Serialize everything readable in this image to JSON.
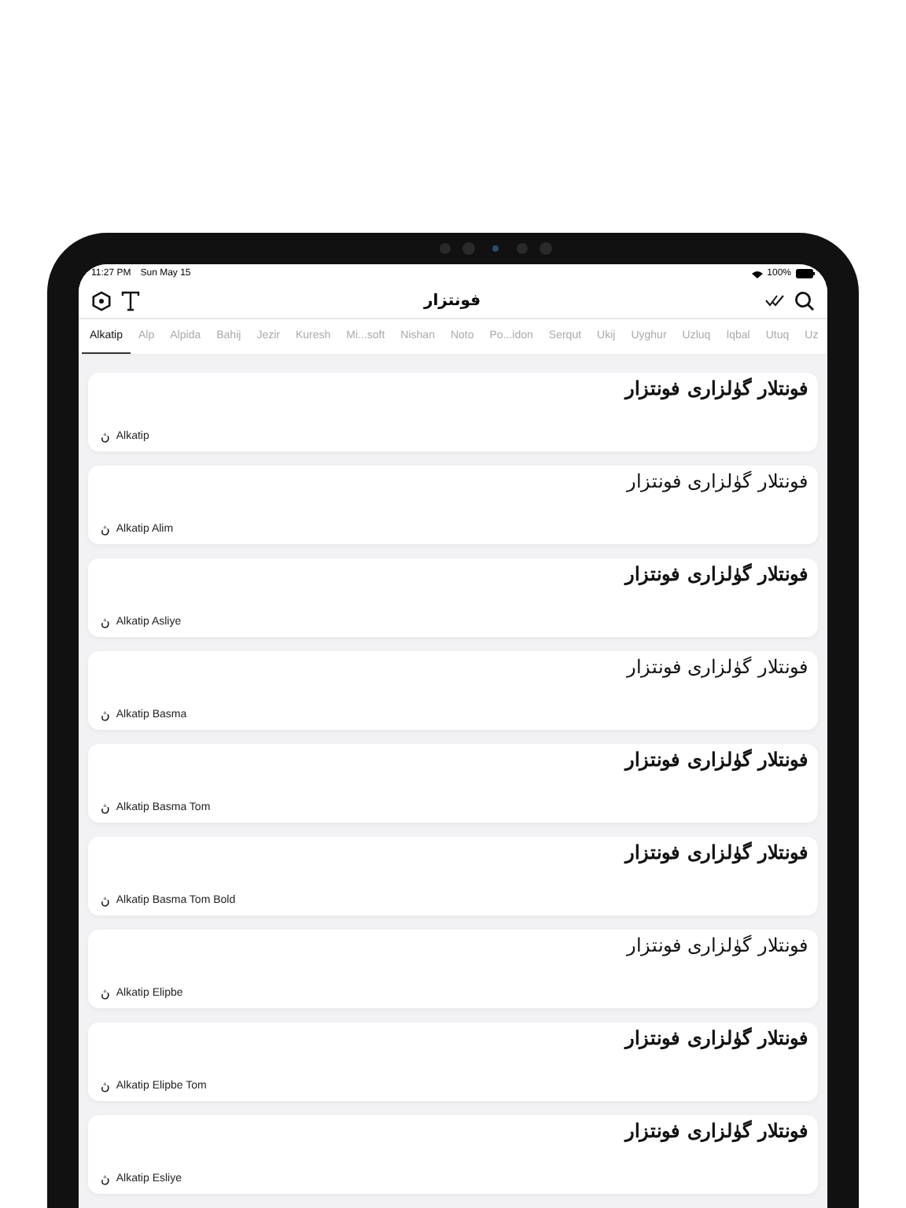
{
  "status_bar": {
    "time": "11:27 PM",
    "date": "Sun May 15",
    "battery": "100%"
  },
  "nav_bar": {
    "title": "فونتزار"
  },
  "tabs": [
    {
      "label": "Alkatip",
      "selected": true
    },
    {
      "label": "Alp",
      "selected": false
    },
    {
      "label": "Alpida",
      "selected": false
    },
    {
      "label": "Bahij",
      "selected": false
    },
    {
      "label": "Jezir",
      "selected": false
    },
    {
      "label": "Kuresh",
      "selected": false
    },
    {
      "label": "Mi...soft",
      "selected": false
    },
    {
      "label": "Nishan",
      "selected": false
    },
    {
      "label": "Noto",
      "selected": false
    },
    {
      "label": "Po...idon",
      "selected": false
    },
    {
      "label": "Serqut",
      "selected": false
    },
    {
      "label": "Ukij",
      "selected": false
    },
    {
      "label": "Uyghur",
      "selected": false
    },
    {
      "label": "Uzluq",
      "selected": false
    },
    {
      "label": "Iqbal",
      "selected": false
    },
    {
      "label": "Utuq",
      "selected": false
    },
    {
      "label": "Uz",
      "selected": false
    }
  ],
  "fonts": [
    {
      "sample": "فونتلار گۈلزارى فونتزار",
      "bold": true,
      "glyph": "ڽ",
      "name": "Alkatip"
    },
    {
      "sample": "فونتلار گۈلزارى فونتزار",
      "bold": false,
      "glyph": "ڽ",
      "name": "Alkatip Alim"
    },
    {
      "sample": "فونتلار گۈلزارى فونتزار",
      "bold": true,
      "glyph": "ڽ",
      "name": "Alkatip Asliye"
    },
    {
      "sample": "فونتلار گۈلزارى فونتزار",
      "bold": false,
      "glyph": "ڽ",
      "name": "Alkatip Basma"
    },
    {
      "sample": "فونتلار گۈلزارى فونتزار",
      "bold": true,
      "glyph": "ڽ",
      "name": "Alkatip Basma Tom"
    },
    {
      "sample": "فونتلار گۈلزارى فونتزار",
      "bold": true,
      "glyph": "ڽ",
      "name": "Alkatip Basma Tom Bold"
    },
    {
      "sample": "فونتلار گۈلزارى فونتزار",
      "bold": false,
      "glyph": "ڽ",
      "name": "Alkatip Elipbe"
    },
    {
      "sample": "فونتلار گۈلزارى فونتزار",
      "bold": true,
      "glyph": "ڽ",
      "name": "Alkatip Elipbe Tom"
    },
    {
      "sample": "فونتلار گۈلزارى فونتزار",
      "bold": true,
      "glyph": "ڽ",
      "name": "Alkatip Esliye"
    }
  ]
}
